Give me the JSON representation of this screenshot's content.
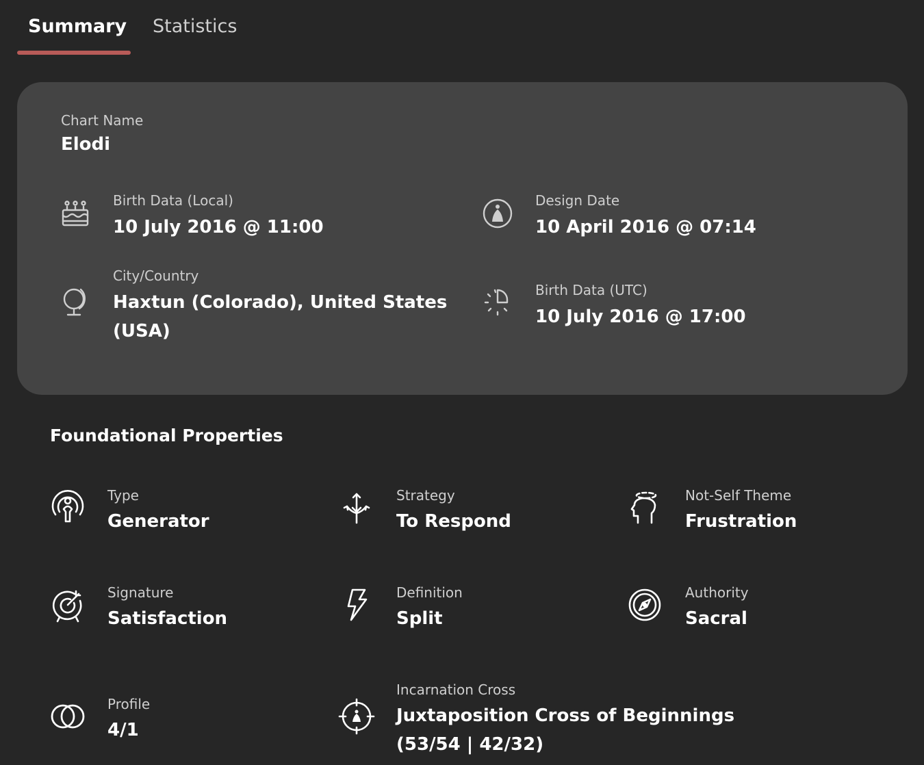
{
  "tabs": {
    "summary": "Summary",
    "statistics": "Statistics"
  },
  "chart": {
    "name_label": "Chart Name",
    "name_value": "Elodi",
    "birth_local_label": "Birth Data (Local)",
    "birth_local_value": "10 July 2016 @ 11:00",
    "design_date_label": "Design Date",
    "design_date_value": "10 April 2016 @ 07:14",
    "city_label": "City/Country",
    "city_value_line1": "Haxtun (Colorado), United States",
    "city_value_line2": "(USA)",
    "birth_utc_label": "Birth Data (UTC)",
    "birth_utc_value": "10 July 2016 @ 17:00"
  },
  "foundational": {
    "title": "Foundational Properties",
    "type_label": "Type",
    "type_value": "Generator",
    "strategy_label": "Strategy",
    "strategy_value": "To Respond",
    "notself_label": "Not-Self Theme",
    "notself_value": "Frustration",
    "signature_label": "Signature",
    "signature_value": "Satisfaction",
    "definition_label": "Definition",
    "definition_value": "Split",
    "authority_label": "Authority",
    "authority_value": "Sacral",
    "profile_label": "Profile",
    "profile_value": "4/1",
    "cross_label": "Incarnation Cross",
    "cross_value_line1": "Juxtaposition Cross of Beginnings",
    "cross_value_line2": "(53/54 | 42/32)"
  },
  "icons": {
    "birth_local": "birthday-cake-icon",
    "design_date": "design-figure-icon",
    "city": "globe-icon",
    "birth_utc": "clock-utc-icon",
    "type": "generator-icon",
    "strategy": "strategy-arrows-icon",
    "notself": "head-icon",
    "signature": "target-icon",
    "definition": "lightning-icon",
    "authority": "compass-icon",
    "profile": "rings-icon",
    "cross": "crosshair-icon"
  },
  "colors": {
    "background": "#262626",
    "card": "#444444",
    "accent_underline": "#b85b58"
  }
}
